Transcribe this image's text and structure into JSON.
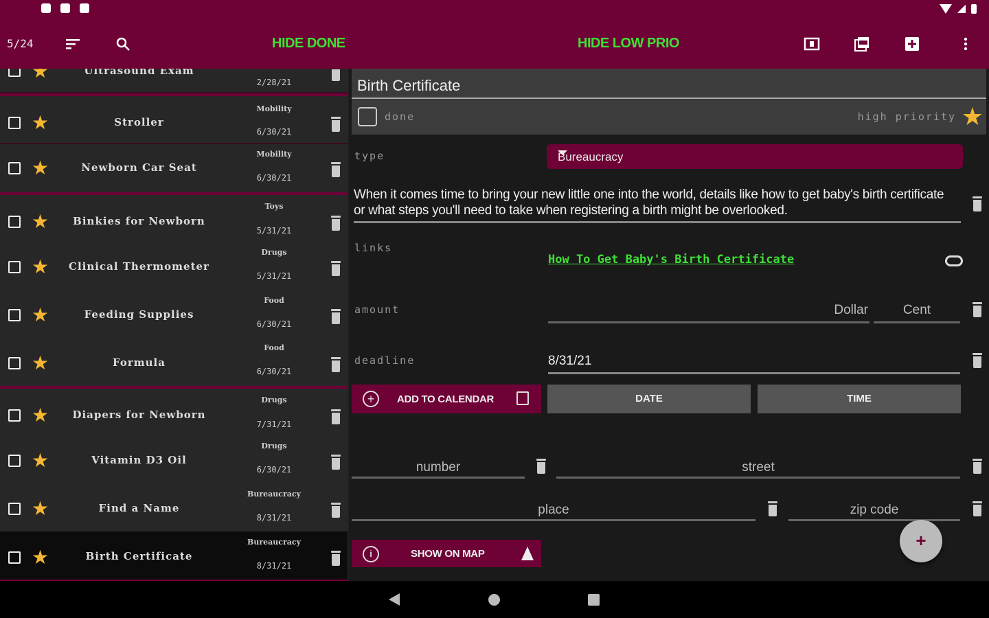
{
  "colors": {
    "accent": "#6e0135",
    "green": "#3ee035",
    "star": "#f5b731"
  },
  "app_bar": {
    "count": "5/24",
    "hide_done": "HIDE DONE",
    "hide_low_prio": "HIDE LOW PRIO",
    "icons": [
      "sort-icon",
      "search-icon",
      "view-icon",
      "pdf-icon",
      "add-box-icon",
      "more-vert-icon"
    ]
  },
  "list": {
    "items": [
      {
        "title": "Ultrasound Exam",
        "category": "",
        "date": "2/28/21"
      },
      {
        "title": "Stroller",
        "category": "Mobility",
        "date": "6/30/21"
      },
      {
        "title": "Newborn Car Seat",
        "category": "Mobility",
        "date": "6/30/21"
      },
      {
        "title": "Binkies for Newborn",
        "category": "Toys",
        "date": "5/31/21"
      },
      {
        "title": "Clinical Thermometer",
        "category": "Drugs",
        "date": "5/31/21"
      },
      {
        "title": "Feeding Supplies",
        "category": "Food",
        "date": "6/30/21"
      },
      {
        "title": "Formula",
        "category": "Food",
        "date": "6/30/21"
      },
      {
        "title": "Diapers for Newborn",
        "category": "Drugs",
        "date": "7/31/21"
      },
      {
        "title": "Vitamin D3 Oil",
        "category": "Drugs",
        "date": "6/30/21"
      },
      {
        "title": "Find a Name",
        "category": "Bureaucracy",
        "date": "8/31/21"
      },
      {
        "title": "Birth Certificate",
        "category": "Bureaucracy",
        "date": "8/31/21"
      }
    ]
  },
  "detail": {
    "title": "Birth Certificate",
    "done_label": "done",
    "priority_label": "high priority",
    "type_label": "type",
    "type_value": "Bureaucracy",
    "description": "When it comes time to bring your new little one into the world, details like how to get baby's birth certificate or what steps you'll need to take when registering a birth might be overlooked.",
    "links_label": "links",
    "link_text": "How To Get Baby's Birth Certificate",
    "amount_label": "amount",
    "dollar_placeholder": "Dollar",
    "cent_placeholder": "Cent",
    "deadline_label": "deadline",
    "deadline_value": "8/31/21",
    "add_to_calendar": "ADD TO CALENDAR",
    "date_button": "DATE",
    "time_button": "TIME",
    "number_placeholder": "number",
    "street_placeholder": "street",
    "place_placeholder": "place",
    "zip_placeholder": "zip code",
    "show_on_map": "SHOW ON MAP",
    "fab": "+"
  }
}
